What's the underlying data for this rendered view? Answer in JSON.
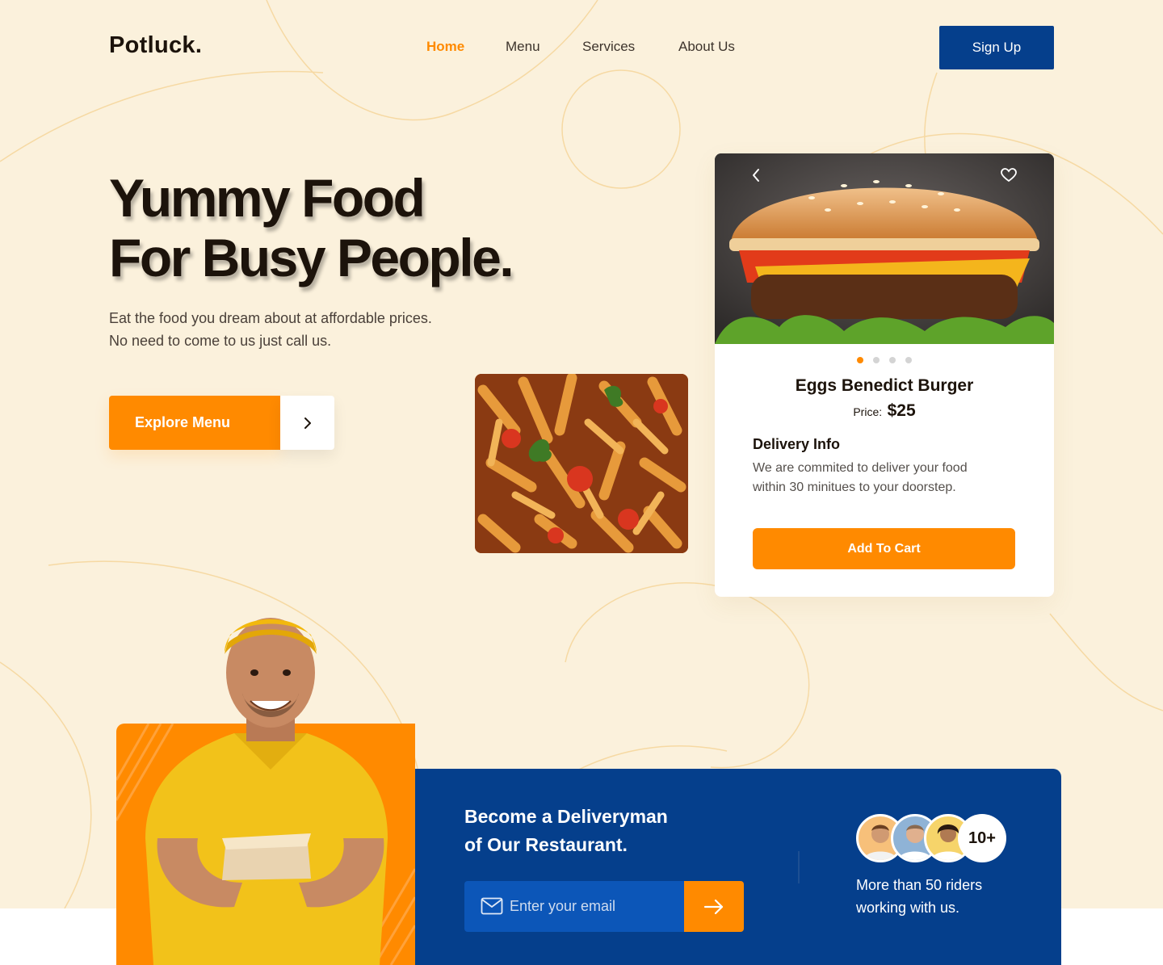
{
  "brand": {
    "logo": "Potluck."
  },
  "nav": {
    "items": [
      {
        "label": "Home",
        "active": true
      },
      {
        "label": "Menu",
        "active": false
      },
      {
        "label": "Services",
        "active": false
      },
      {
        "label": "About Us",
        "active": false
      }
    ],
    "signup_label": "Sign Up"
  },
  "hero": {
    "headline_line1": "Yummy Food",
    "headline_line2": "For Busy People.",
    "sub_line1": "Eat the food you dream about at affordable prices.",
    "sub_line2": "No need to come to us just call us.",
    "cta_label": "Explore Menu",
    "cta_icon": "chevron-right-icon"
  },
  "product_card": {
    "prev_icon": "chevron-left-icon",
    "favorite_icon": "heart-icon",
    "carousel_total": 4,
    "carousel_active": 1,
    "title": "Eggs Benedict Burger",
    "price_label": "Price:",
    "price_value": "$25",
    "delivery_title": "Delivery Info",
    "delivery_line1": "We are commited to deliver your food",
    "delivery_line2": "within 30 minitues to your doorstep.",
    "add_to_cart_label": "Add To Cart"
  },
  "deliveryman": {
    "title_line1": "Become a Deliveryman",
    "title_line2": "of Our Restaurant.",
    "email_placeholder": "Enter your email",
    "email_icon": "mail-icon",
    "submit_icon": "arrow-right-icon",
    "riders_count": "10+",
    "riders_line1": "More than 50 riders",
    "riders_line2": "working with us."
  },
  "colors": {
    "accent": "#ff8a00",
    "primary": "#053f8c",
    "background": "#fbf1dc",
    "text": "#1c130b"
  }
}
